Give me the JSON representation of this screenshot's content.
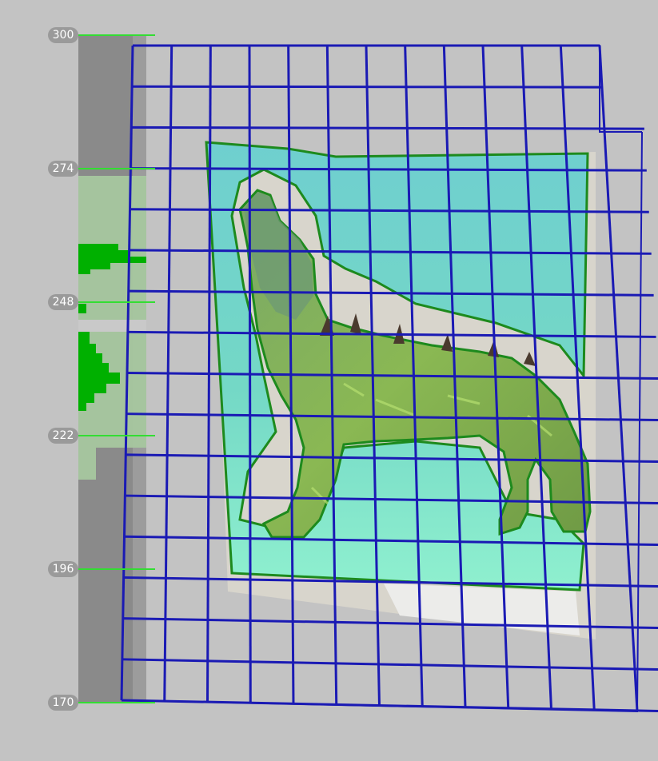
{
  "histogram": {
    "ticks": [
      "300",
      "274",
      "248",
      "222",
      "196",
      "170"
    ],
    "tick_color": "#33dd33",
    "label_bg": "#9a9a9a",
    "bar_color": "#00b000"
  },
  "scene": {
    "grid_color": "#1a1ab4",
    "plane_color": "#6fd9c9",
    "outline_color": "#1d8a1d",
    "object": "wolf-figure"
  }
}
